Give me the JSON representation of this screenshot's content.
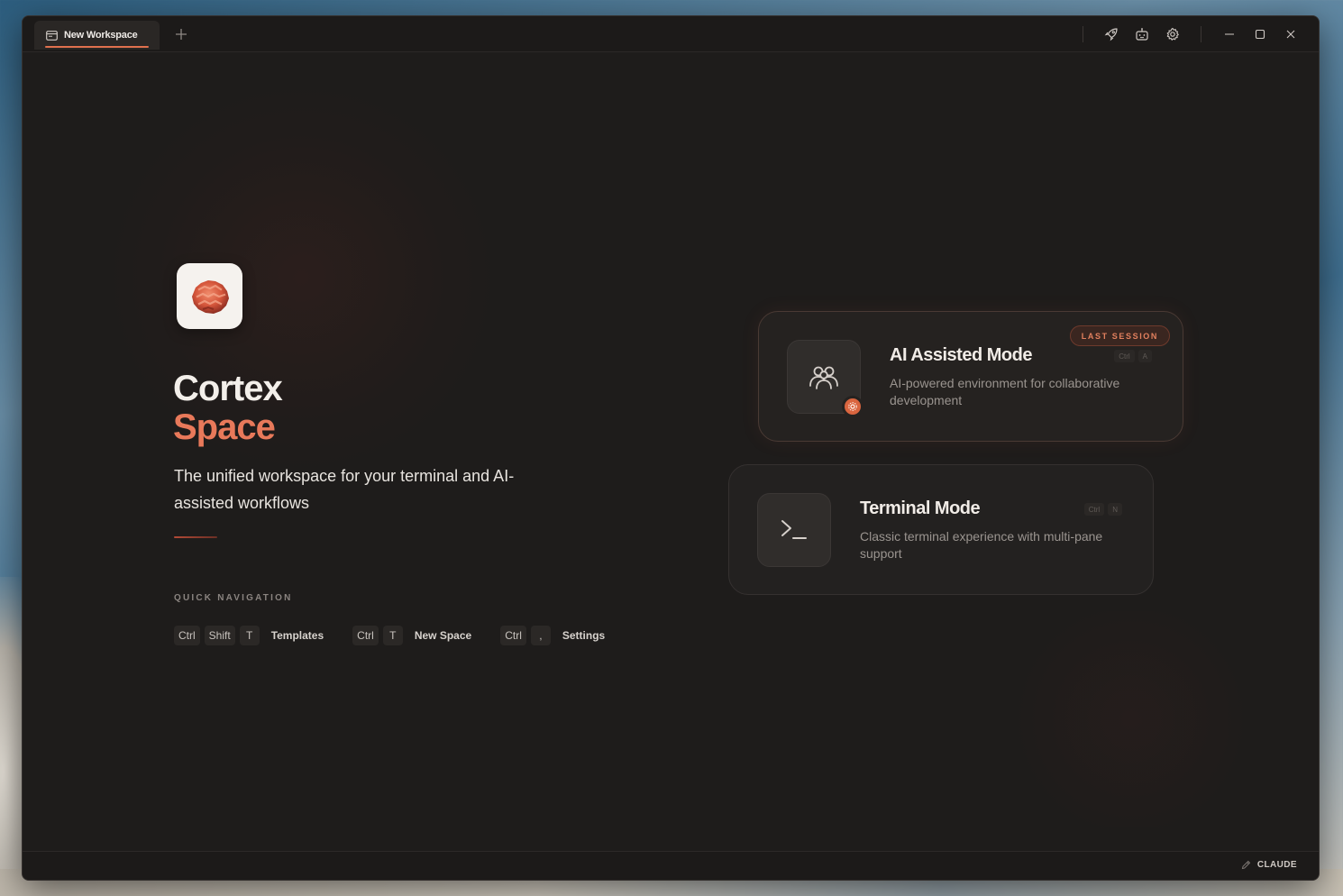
{
  "tabs": [
    {
      "label": "New Workspace",
      "active": true
    }
  ],
  "hero": {
    "title_primary": "Cortex",
    "title_accent": "Space",
    "tagline": "The unified workspace for your terminal and AI-assisted workflows"
  },
  "quick_nav": {
    "heading": "QUICK NAVIGATION",
    "shortcuts": [
      {
        "keys": [
          "Ctrl",
          "Shift",
          "T"
        ],
        "label": "Templates"
      },
      {
        "keys": [
          "Ctrl",
          "T"
        ],
        "label": "New Space"
      },
      {
        "keys": [
          "Ctrl",
          ","
        ],
        "label": "Settings"
      }
    ]
  },
  "modes": {
    "ai": {
      "title": "AI Assisted Mode",
      "description": "AI-powered environment for collaborative development",
      "badge": "LAST SESSION",
      "keys": [
        "Ctrl",
        "A"
      ]
    },
    "terminal": {
      "title": "Terminal Mode",
      "description": "Classic terminal experience with multi-pane support",
      "keys": [
        "Ctrl",
        "N"
      ]
    }
  },
  "status": {
    "provider": "CLAUDE"
  },
  "colors": {
    "accent": "#e8795a",
    "background": "#1e1c1b",
    "card": "#252220"
  }
}
